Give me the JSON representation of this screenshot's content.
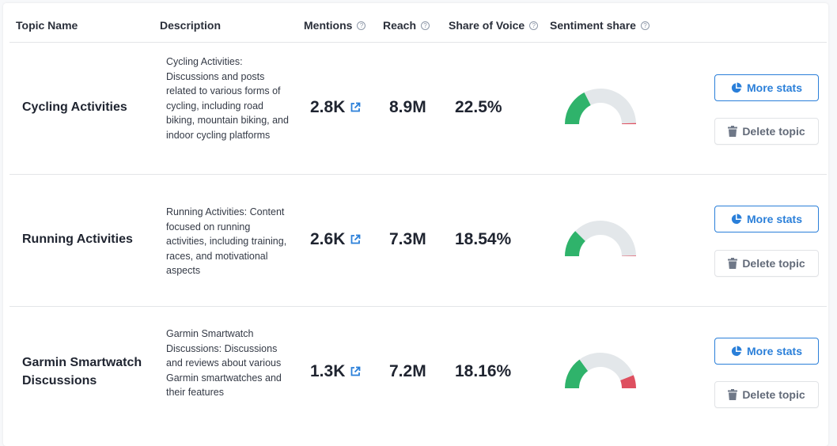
{
  "table": {
    "columns": [
      {
        "label": "Topic Name",
        "help": false
      },
      {
        "label": "Description",
        "help": false
      },
      {
        "label": "Mentions",
        "help": true
      },
      {
        "label": "Reach",
        "help": true
      },
      {
        "label": "Share of Voice",
        "help": true
      },
      {
        "label": "Sentiment share",
        "help": true
      }
    ],
    "help_glyph": "?",
    "rows": [
      {
        "topic": "Cycling Activities",
        "description": "Cycling Activities: Discussions and posts related to various forms of cycling, including road biking, mountain biking, and indoor cycling platforms",
        "mentions": "2.8K",
        "reach": "8.9M",
        "share_of_voice": "22.5%",
        "sentiment": {
          "positive": 0.35,
          "neutral": 0.64,
          "negative": 0.01
        },
        "more_stats_label": "More stats",
        "delete_label": "Delete topic"
      },
      {
        "topic": "Running Activities",
        "description": "Running Activities: Content focused on running activities, including training, races, and motivational aspects",
        "mentions": "2.6K",
        "reach": "7.3M",
        "share_of_voice": "18.54%",
        "sentiment": {
          "positive": 0.25,
          "neutral": 0.745,
          "negative": 0.005
        },
        "more_stats_label": "More stats",
        "delete_label": "Delete topic"
      },
      {
        "topic": "Garmin Smartwatch Discussions",
        "description": "Garmin Smartwatch Discussions: Discussions and reviews about various Garmin smartwatches and their features",
        "mentions": "1.3K",
        "reach": "7.2M",
        "share_of_voice": "18.16%",
        "sentiment": {
          "positive": 0.3,
          "neutral": 0.58,
          "negative": 0.12
        },
        "more_stats_label": "More stats",
        "delete_label": "Delete topic"
      }
    ]
  },
  "colors": {
    "positive": "#2fb36b",
    "neutral": "#e3e7ea",
    "negative": "#de4f5f",
    "accent": "#2a7fd9"
  }
}
